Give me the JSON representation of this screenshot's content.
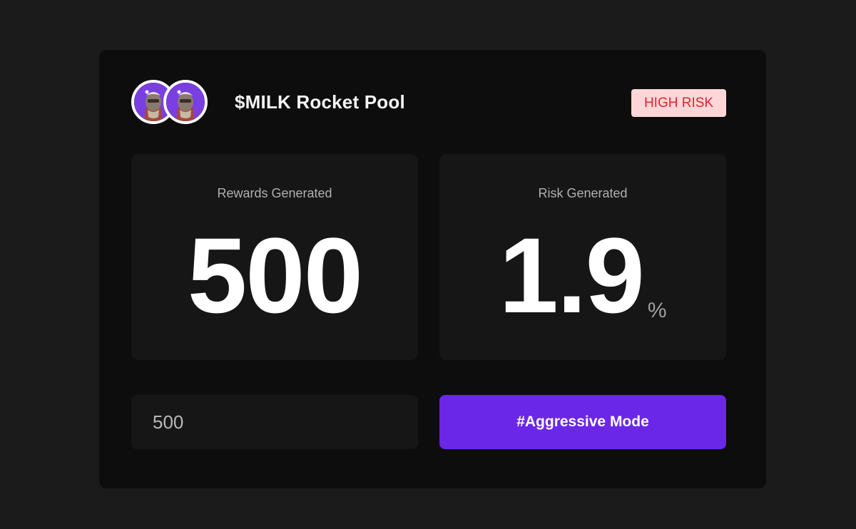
{
  "pool": {
    "title": "$MILK Rocket Pool",
    "risk_badge": "HIGH RISK"
  },
  "stats": {
    "rewards": {
      "label": "Rewards Generated",
      "value": "500"
    },
    "risk": {
      "label": "Risk Generated",
      "value": "1.9",
      "unit": "%"
    }
  },
  "amount_input": {
    "value": "500"
  },
  "mode_button": {
    "label": "#Aggressive Mode"
  },
  "colors": {
    "page_bg": "#1b1b1b",
    "card_bg": "#0d0d0d",
    "panel_bg": "#161616",
    "accent": "#6a27e8",
    "badge_bg": "#ffd6d8",
    "badge_text": "#e0242e",
    "avatar_bg": "#7a3fe0"
  },
  "icons": [
    "token-avatar-icon",
    "token-avatar-icon"
  ]
}
